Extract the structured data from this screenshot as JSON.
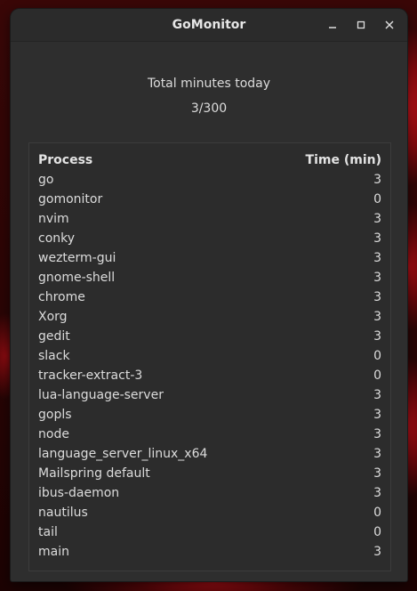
{
  "window": {
    "title": "GoMonitor"
  },
  "summary": {
    "label": "Total minutes today",
    "value": "3/300"
  },
  "table": {
    "headers": [
      "Process",
      "Time (min)"
    ],
    "rows": [
      {
        "process": "go",
        "time": "3"
      },
      {
        "process": "gomonitor",
        "time": "0"
      },
      {
        "process": "nvim",
        "time": "3"
      },
      {
        "process": "conky",
        "time": "3"
      },
      {
        "process": "wezterm-gui",
        "time": "3"
      },
      {
        "process": "gnome-shell",
        "time": "3"
      },
      {
        "process": "chrome",
        "time": "3"
      },
      {
        "process": "Xorg",
        "time": "3"
      },
      {
        "process": "gedit",
        "time": "3"
      },
      {
        "process": "slack",
        "time": "0"
      },
      {
        "process": "tracker-extract-3",
        "time": "0"
      },
      {
        "process": "lua-language-server",
        "time": "3"
      },
      {
        "process": "gopls",
        "time": "3"
      },
      {
        "process": "node",
        "time": "3"
      },
      {
        "process": "language_server_linux_x64",
        "time": "3"
      },
      {
        "process": "Mailspring default",
        "time": "3"
      },
      {
        "process": "ibus-daemon",
        "time": "3"
      },
      {
        "process": "nautilus",
        "time": "0"
      },
      {
        "process": "tail",
        "time": "0"
      },
      {
        "process": "main",
        "time": "3"
      }
    ]
  },
  "icons": {
    "minimize": "minimize-icon",
    "maximize": "maximize-icon",
    "close": "close-icon"
  },
  "colors": {
    "window_bg": "#2e2e2e",
    "text": "#dcdcdc",
    "desktop_accent": "#c0121a"
  }
}
